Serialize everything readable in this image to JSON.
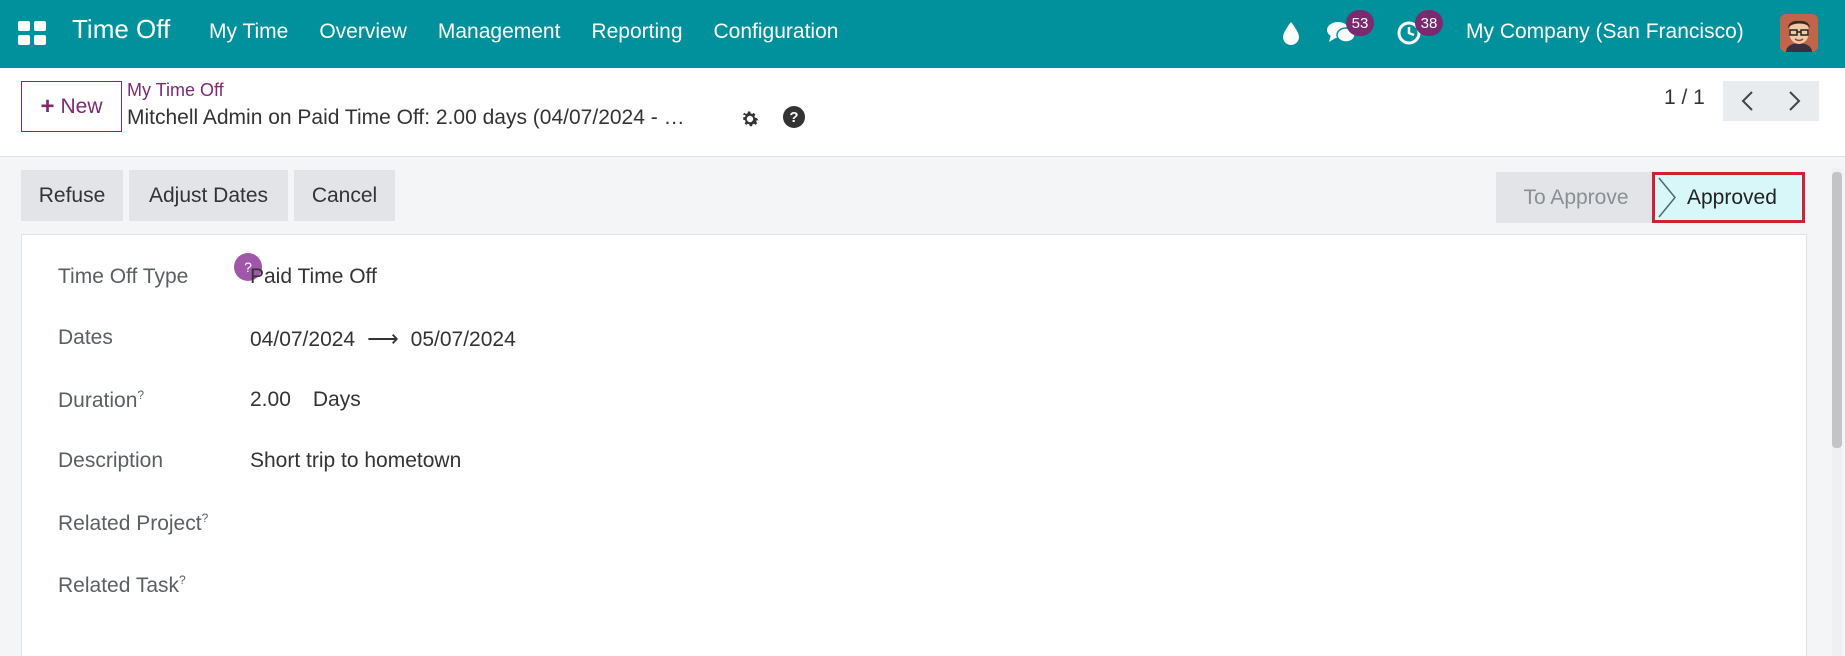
{
  "navbar": {
    "app_title": "Time Off",
    "menu": [
      "My Time",
      "Overview",
      "Management",
      "Reporting",
      "Configuration"
    ],
    "chat_count": "53",
    "activity_count": "38",
    "company": "My Company (San Francisco)",
    "color": "#00919c"
  },
  "control": {
    "new_label": "New",
    "breadcrumb": "My Time Off",
    "record_title": "Mitchell Admin on Paid Time Off: 2.00 days (04/07/2024 - …",
    "pager": "1 / 1"
  },
  "actions": {
    "refuse": "Refuse",
    "adjust_dates": "Adjust Dates",
    "cancel": "Cancel"
  },
  "status": {
    "steps": [
      "To Approve",
      "Approved"
    ],
    "current": "Approved"
  },
  "form": {
    "time_off_type": {
      "label": "Time Off Type",
      "value": "Paid Time Off"
    },
    "dates": {
      "label": "Dates",
      "from": "04/07/2024",
      "to": "05/07/2024"
    },
    "duration": {
      "label": "Duration",
      "value": "2.00",
      "unit": "Days"
    },
    "description": {
      "label": "Description",
      "value": "Short trip to hometown"
    },
    "related_project": {
      "label": "Related Project",
      "value": ""
    },
    "related_task": {
      "label": "Related Task",
      "value": ""
    }
  }
}
